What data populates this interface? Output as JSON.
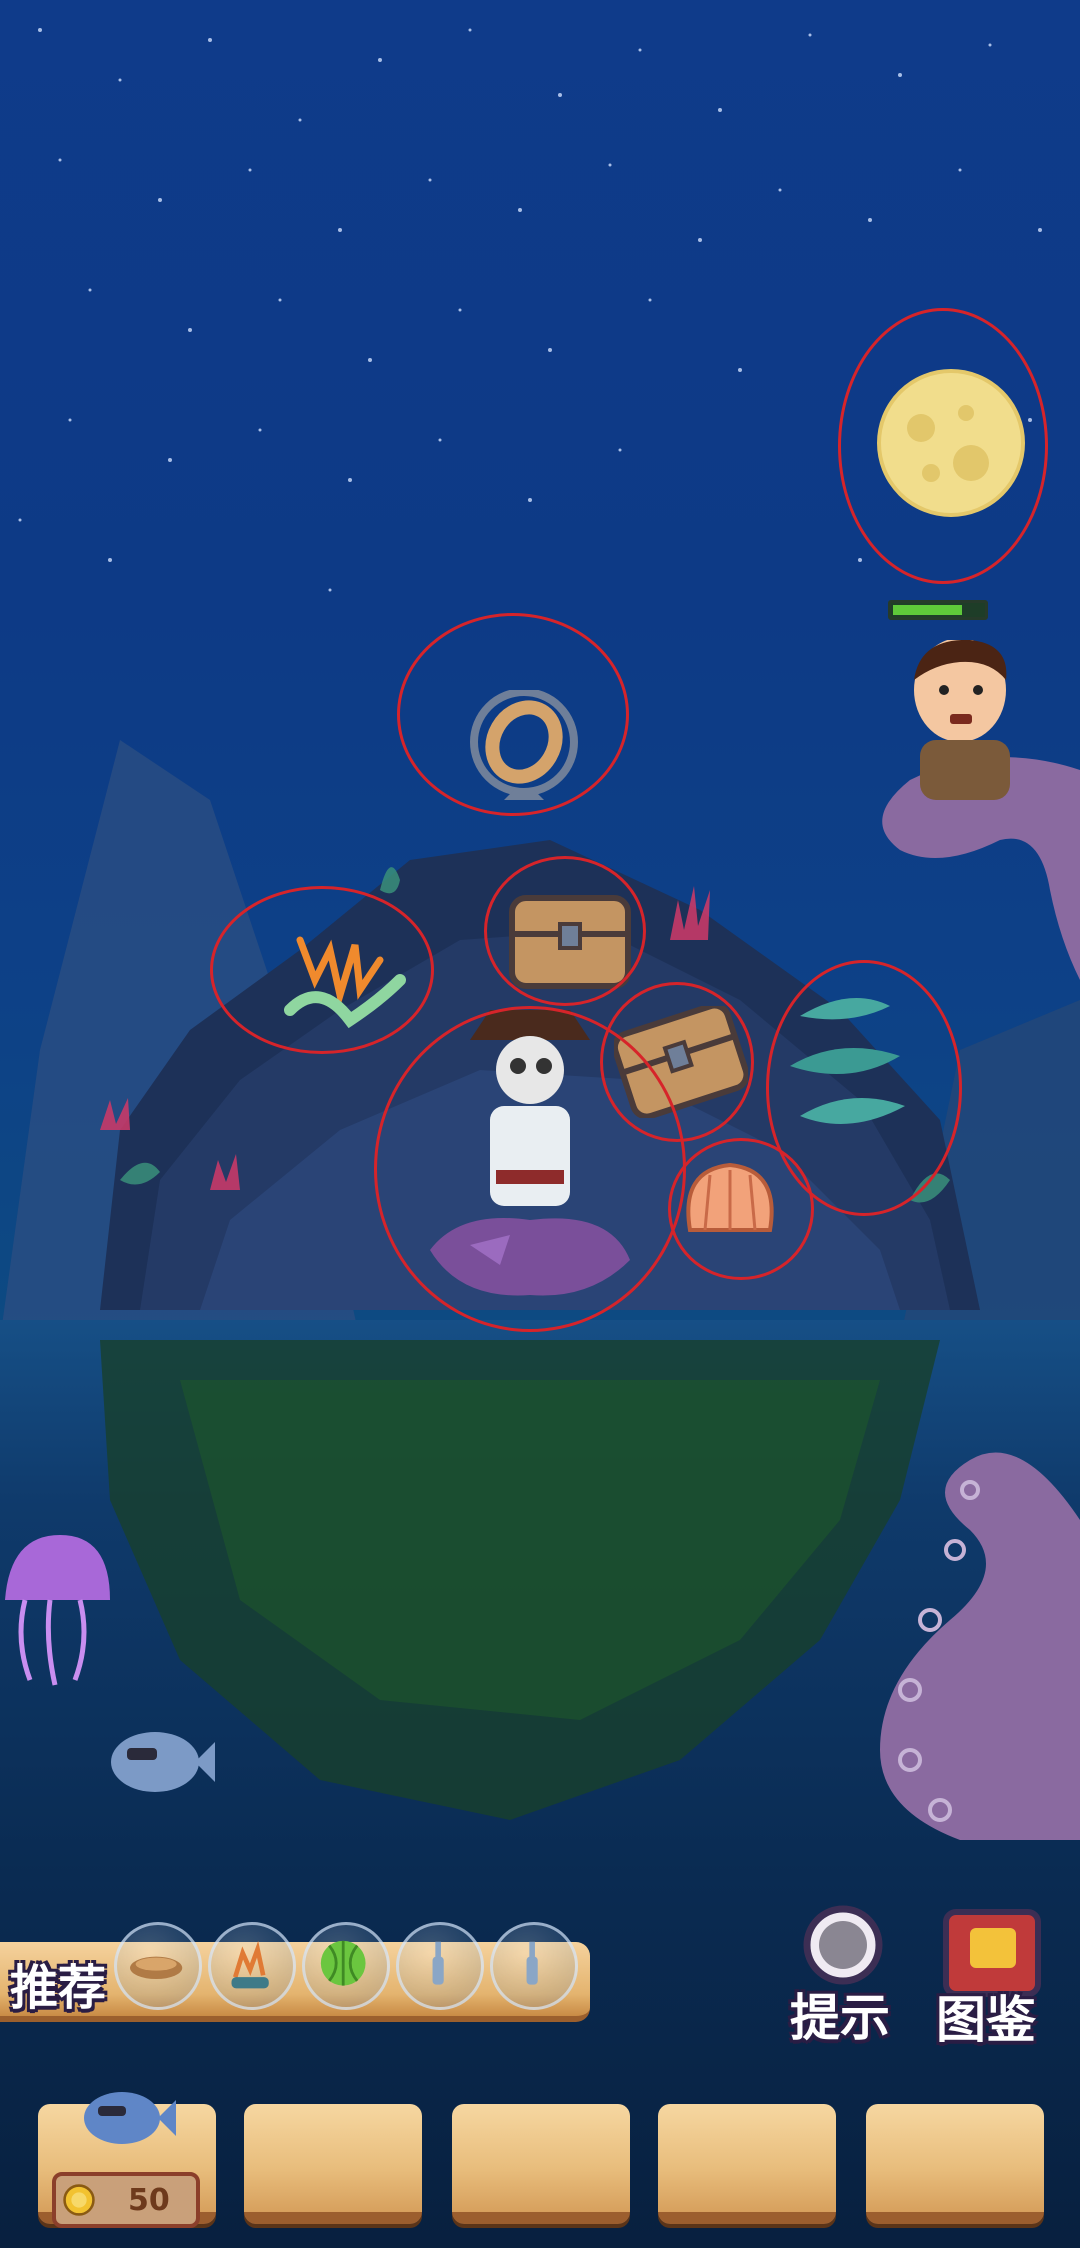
{
  "hud": {
    "recommend_label": "推荐",
    "hint_label": "提示",
    "catalog_label": "图鉴",
    "coin_count": "50"
  },
  "recommend_items": [
    {
      "name": "sandals-icon"
    },
    {
      "name": "coral-icon"
    },
    {
      "name": "watermelon-icon"
    },
    {
      "name": "bottle-icon"
    },
    {
      "name": "bottle-icon"
    }
  ],
  "moon_health": {
    "filled": 3,
    "total": 4
  },
  "found_markers": [
    "moon",
    "life-ring",
    "treasure-chest",
    "coral",
    "skeleton-pirate",
    "treasure-chest",
    "seaweed",
    "scallop-shell"
  ],
  "colors": {
    "circle": "#d6242a",
    "health": "#5fc83a",
    "sky": "#0f3b8a",
    "wood": "#e8bd7c"
  }
}
